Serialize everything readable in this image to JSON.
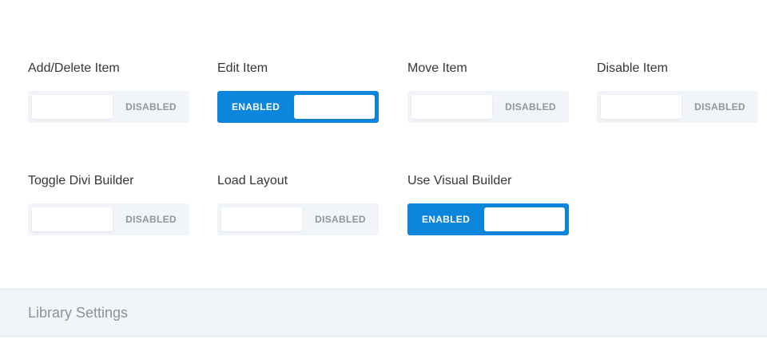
{
  "options": [
    {
      "label": "Add/Delete Item",
      "state": "DISABLED",
      "enabled": false
    },
    {
      "label": "Edit Item",
      "state": "ENABLED",
      "enabled": true
    },
    {
      "label": "Move Item",
      "state": "DISABLED",
      "enabled": false
    },
    {
      "label": "Disable Item",
      "state": "DISABLED",
      "enabled": false
    },
    {
      "label": "Toggle Divi Builder",
      "state": "DISABLED",
      "enabled": false
    },
    {
      "label": "Load Layout",
      "state": "DISABLED",
      "enabled": false
    },
    {
      "label": "Use Visual Builder",
      "state": "ENABLED",
      "enabled": true
    }
  ],
  "section": {
    "title": "Library Settings"
  },
  "colors": {
    "accent": "#0c85dc",
    "toggle_off_bg": "#f1f4f8"
  }
}
